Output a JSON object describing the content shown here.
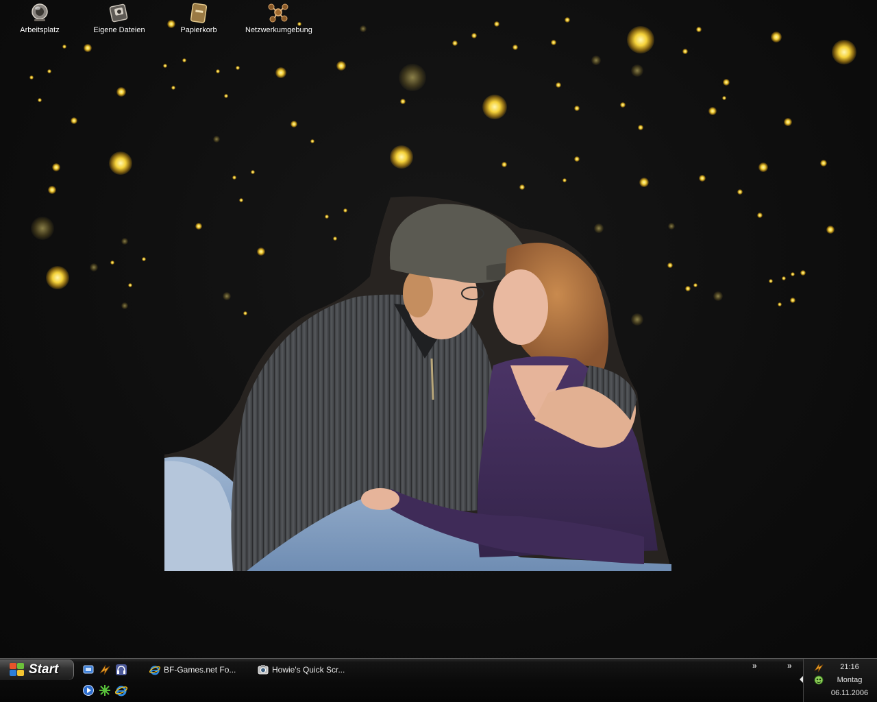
{
  "desktop": {
    "icons": [
      {
        "label": "Arbeitsplatz",
        "icon": "my-computer-icon"
      },
      {
        "label": "Eigene Dateien",
        "icon": "my-documents-icon"
      },
      {
        "label": "Papierkorb",
        "icon": "recycle-bin-icon"
      },
      {
        "label": "Netzwerkumgebung",
        "icon": "network-places-icon"
      }
    ],
    "wallpaper": "couple-kissing-photo",
    "colors": {
      "background": "#0e0e0e",
      "star": "#f5d23a"
    }
  },
  "taskbar": {
    "start_label": "Start",
    "quick_launch": [
      {
        "icon": "show-desktop-icon"
      },
      {
        "icon": "winamp-icon"
      },
      {
        "icon": "headset-icon"
      },
      {
        "icon": "media-player-icon"
      },
      {
        "icon": "games-icon"
      },
      {
        "icon": "internet-explorer-icon"
      }
    ],
    "tasks": [
      {
        "label": "BF-Games.net Fo...",
        "icon": "internet-explorer-icon"
      },
      {
        "label": "Howie's Quick Scr...",
        "icon": "screenshot-tool-icon"
      }
    ],
    "toolbar_chevrons": [
      "»",
      "»"
    ]
  },
  "tray": {
    "time": "21:16",
    "day": "Montag",
    "date": "06.11.2006",
    "icons": [
      "winamp-tray-icon",
      "antivirus-tray-icon",
      "diamond-tray-icon"
    ]
  }
}
